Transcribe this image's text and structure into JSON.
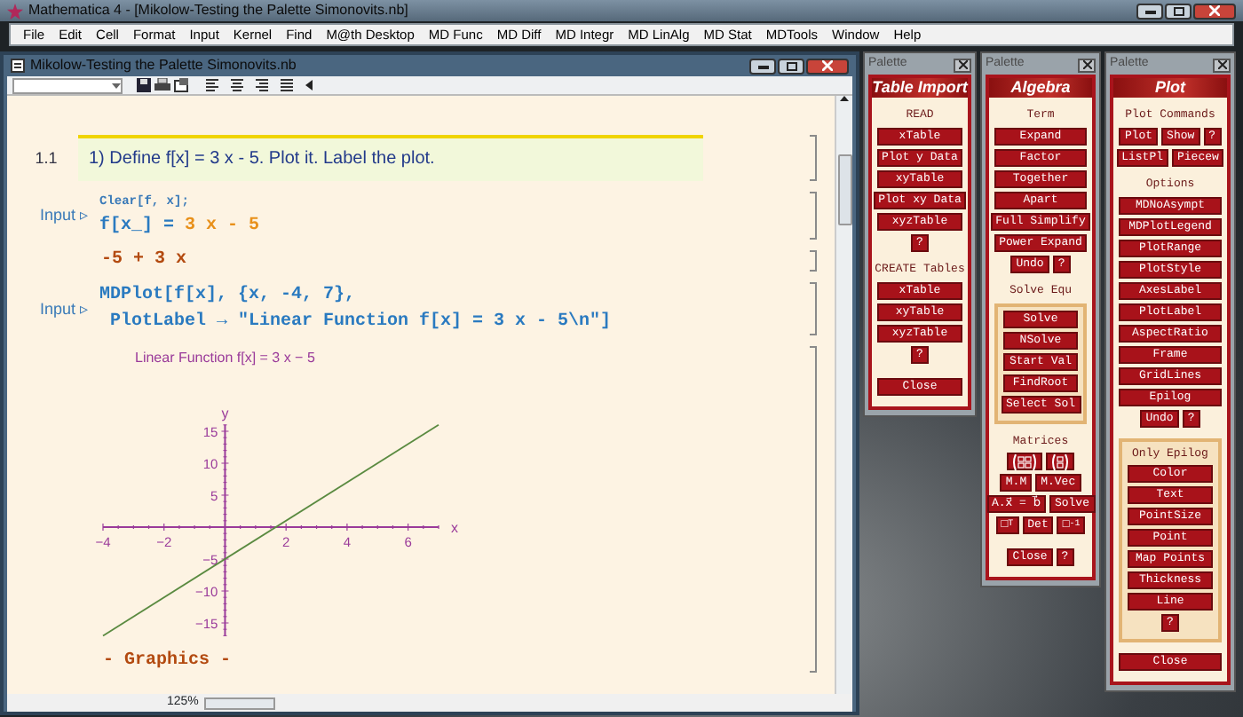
{
  "app_window": {
    "title": "Mathematica 4 - [Mikolow-Testing the Palette Simonovits.nb]"
  },
  "menu": [
    "File",
    "Edit",
    "Cell",
    "Format",
    "Input",
    "Kernel",
    "Find",
    "M@th Desktop",
    "MD Func",
    "MD Diff",
    "MD Integr",
    "MD LinAlg",
    "MD Stat",
    "MDTools",
    "Window",
    "Help"
  ],
  "notebook": {
    "title": "Mikolow-Testing the Palette Simonovits.nb",
    "zoom": "125%",
    "cells": [
      {
        "kind": "section",
        "number": "1.1",
        "text": "1) Define f[x] = 3 x - 5. Plot it. Label the plot."
      },
      {
        "kind": "input",
        "label": "Input ▹",
        "lines": [
          [
            {
              "kind": "small",
              "text": "Clear[f, x];"
            }
          ],
          [
            {
              "kind": "code",
              "text": "f[x_] = "
            },
            {
              "kind": "value",
              "text": "3 x - 5"
            }
          ]
        ]
      },
      {
        "kind": "output",
        "text": "-5 + 3 x"
      },
      {
        "kind": "input",
        "label": "Input ▹",
        "lines": [
          [
            {
              "kind": "code",
              "text": "MDPlot[f[x], {x, -4, 7},"
            }
          ],
          [
            {
              "kind": "code",
              "text": " PlotLabel → \"Linear Function f[x] = 3 x - 5\\n\"]"
            }
          ]
        ]
      },
      {
        "kind": "graphics",
        "caption": "- Graphics -",
        "chart_data": {
          "type": "line",
          "title": "Linear Function f[x] = 3 x − 5",
          "xlabel": "x",
          "ylabel": "y",
          "x": [
            -4,
            7
          ],
          "series": [
            {
              "color": "#5a8a40",
              "values": [
                -17,
                16
              ]
            }
          ],
          "xlim": [
            -4,
            7
          ],
          "ylim": [
            -17,
            16
          ],
          "xticks": [
            -4,
            -2,
            2,
            4,
            6
          ],
          "yticks": [
            -15,
            -10,
            -5,
            5,
            10,
            15
          ]
        }
      }
    ]
  },
  "palettes": [
    {
      "title": "Palette",
      "banner": "Table Import",
      "sections": [
        {
          "heading": "READ",
          "framed": false,
          "rows": [
            [
              {
                "kind": "text",
                "label": "xTable"
              }
            ],
            [
              {
                "kind": "text",
                "label": "Plot y Data"
              }
            ],
            [
              {
                "kind": "text",
                "label": "xyTable"
              }
            ],
            [
              {
                "kind": "text",
                "label": "Plot xy Data"
              }
            ],
            [
              {
                "kind": "text",
                "label": "xyzTable"
              }
            ],
            [
              {
                "kind": "text",
                "label": "?"
              }
            ]
          ]
        },
        {
          "heading": "CREATE Tables",
          "framed": false,
          "rows": [
            [
              {
                "kind": "text",
                "label": "xTable"
              }
            ],
            [
              {
                "kind": "text",
                "label": "xyTable"
              }
            ],
            [
              {
                "kind": "text",
                "label": "xyzTable"
              }
            ],
            [
              {
                "kind": "text",
                "label": "?"
              }
            ]
          ]
        },
        {
          "framed": false,
          "rows": [
            [
              {
                "kind": "text",
                "label": "Close"
              }
            ]
          ]
        }
      ]
    },
    {
      "title": "Palette",
      "banner": "Algebra",
      "sections": [
        {
          "heading": "Term",
          "framed": false,
          "rows": [
            [
              {
                "kind": "text",
                "label": "Expand"
              }
            ],
            [
              {
                "kind": "text",
                "label": "Factor"
              }
            ],
            [
              {
                "kind": "text",
                "label": "Together"
              }
            ],
            [
              {
                "kind": "text",
                "label": "Apart"
              }
            ],
            [
              {
                "kind": "text",
                "label": "Full Simplify"
              }
            ],
            [
              {
                "kind": "text",
                "label": "Power Expand"
              }
            ],
            [
              {
                "kind": "text",
                "label": "Undo"
              },
              {
                "kind": "text",
                "label": "?"
              }
            ]
          ]
        },
        {
          "heading": "Solve Equ",
          "framed": true,
          "heading_in_frame": false,
          "rows": [
            [
              {
                "kind": "text",
                "label": "Solve"
              }
            ],
            [
              {
                "kind": "text",
                "label": "NSolve"
              }
            ],
            [
              {
                "kind": "text",
                "label": "Start Val"
              }
            ],
            [
              {
                "kind": "text",
                "label": "FindRoot"
              }
            ],
            [
              {
                "kind": "text",
                "label": "Select Sol"
              }
            ]
          ]
        },
        {
          "heading": "Matrices",
          "framed": false,
          "rows": [
            [
              {
                "kind": "matrix"
              },
              {
                "kind": "vector"
              }
            ],
            [
              {
                "kind": "text",
                "label": "M.M"
              },
              {
                "kind": "text",
                "label": "M.Vec"
              }
            ],
            [
              {
                "kind": "text",
                "label": "A.x⃗ = b⃗"
              },
              {
                "kind": "text",
                "label": "Solve"
              }
            ],
            [
              {
                "kind": "text",
                "label": "□$^{T}$"
              },
              {
                "kind": "text",
                "label": "Det"
              },
              {
                "kind": "text",
                "label": "□$^{-1}$"
              }
            ]
          ]
        },
        {
          "framed": false,
          "rows": [
            [
              {
                "kind": "text",
                "label": "Close"
              },
              {
                "kind": "text",
                "label": "?"
              }
            ]
          ]
        }
      ]
    },
    {
      "title": "Palette",
      "banner": "Plot",
      "sections": [
        {
          "heading": "Plot Commands",
          "framed": false,
          "rows": [
            [
              {
                "kind": "text",
                "label": "Plot"
              },
              {
                "kind": "text",
                "label": "Show"
              },
              {
                "kind": "text",
                "label": "?"
              }
            ],
            [
              {
                "kind": "text",
                "label": "ListPl"
              },
              {
                "kind": "text",
                "label": "Piecew"
              }
            ]
          ]
        },
        {
          "heading": "Options",
          "framed": false,
          "rows": [
            [
              {
                "kind": "text",
                "label": "MDNoAsympt"
              }
            ],
            [
              {
                "kind": "text",
                "label": "MDPlotLegend"
              }
            ],
            [
              {
                "kind": "text",
                "label": "PlotRange"
              }
            ],
            [
              {
                "kind": "text",
                "label": "PlotStyle"
              }
            ],
            [
              {
                "kind": "text",
                "label": "AxesLabel"
              }
            ],
            [
              {
                "kind": "text",
                "label": "PlotLabel"
              }
            ],
            [
              {
                "kind": "text",
                "label": "AspectRatio"
              }
            ],
            [
              {
                "kind": "text",
                "label": "Frame"
              }
            ],
            [
              {
                "kind": "text",
                "label": "GridLines"
              }
            ],
            [
              {
                "kind": "text",
                "label": "Epilog"
              }
            ],
            [
              {
                "kind": "text",
                "label": "Undo"
              },
              {
                "kind": "text",
                "label": "?"
              }
            ]
          ]
        },
        {
          "heading": "Only Epilog",
          "framed": true,
          "heading_in_frame": true,
          "rows": [
            [
              {
                "kind": "text",
                "label": "Color"
              }
            ],
            [
              {
                "kind": "text",
                "label": "Text"
              }
            ],
            [
              {
                "kind": "text",
                "label": "PointSize"
              }
            ],
            [
              {
                "kind": "text",
                "label": "Point"
              }
            ],
            [
              {
                "kind": "text",
                "label": "Map Points"
              }
            ],
            [
              {
                "kind": "text",
                "label": "Thickness"
              }
            ],
            [
              {
                "kind": "text",
                "label": "Line"
              }
            ],
            [
              {
                "kind": "text",
                "label": "?"
              }
            ]
          ]
        },
        {
          "framed": false,
          "rows": [
            [
              {
                "kind": "text",
                "label": "Close"
              }
            ]
          ]
        }
      ]
    }
  ]
}
